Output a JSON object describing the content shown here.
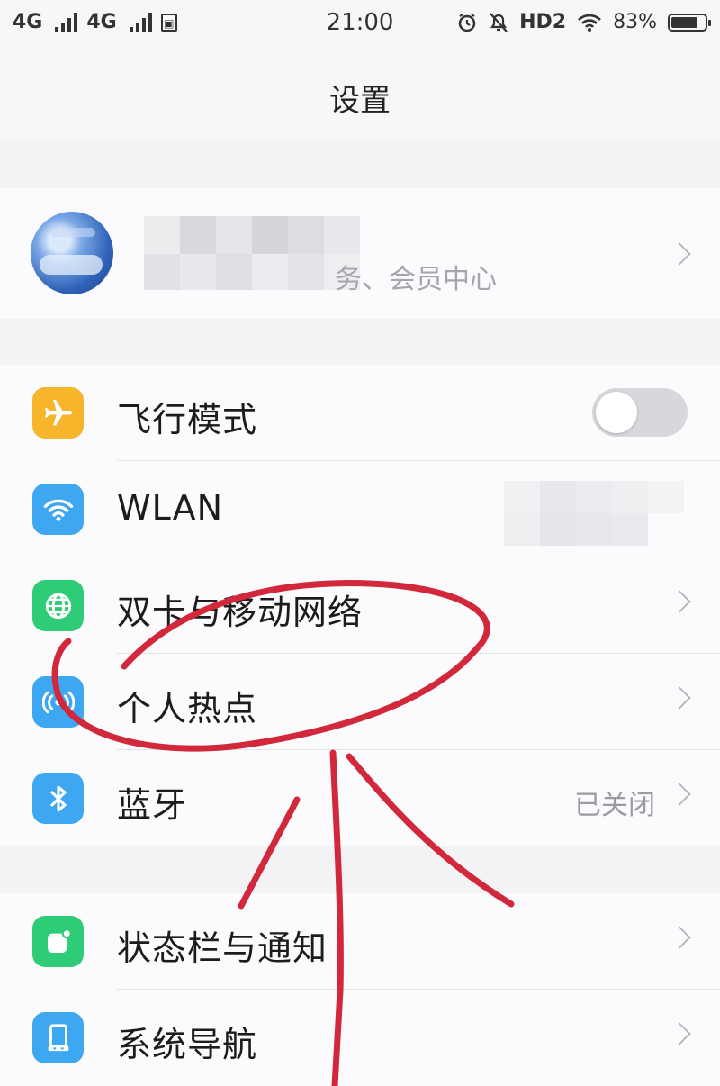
{
  "status_bar": {
    "network_1": "4G",
    "network_2": "4G",
    "time": "21:00",
    "hd_label": "HD2",
    "battery_percent": "83%",
    "battery_level": 0.83
  },
  "header": {
    "title": "设置"
  },
  "profile": {
    "subtitle_visible": "务、会员中心"
  },
  "groups": {
    "network": [
      {
        "label": "飞行模式",
        "icon": "airplane-icon",
        "icon_bg": "#f7b52c",
        "control": "toggle",
        "toggle_on": false
      },
      {
        "label": "WLAN",
        "icon": "wifi-icon",
        "icon_bg": "#3da7f2",
        "control": "none"
      },
      {
        "label": "双卡与移动网络",
        "icon": "globe-icon",
        "icon_bg": "#2fcc78",
        "control": "chevron"
      },
      {
        "label": "个人热点",
        "icon": "hotspot-icon",
        "icon_bg": "#3da7f2",
        "control": "chevron"
      },
      {
        "label": "蓝牙",
        "icon": "bluetooth-icon",
        "icon_bg": "#3da7f2",
        "control": "chevron",
        "value": "已关闭"
      }
    ],
    "system": [
      {
        "label": "状态栏与通知",
        "icon": "notification-icon",
        "icon_bg": "#2fcc78",
        "control": "chevron"
      },
      {
        "label": "系统导航",
        "icon": "navigation-icon",
        "icon_bg": "#3da7f2",
        "control": "chevron"
      }
    ]
  },
  "colors": {
    "annotation": "#d2283c"
  }
}
